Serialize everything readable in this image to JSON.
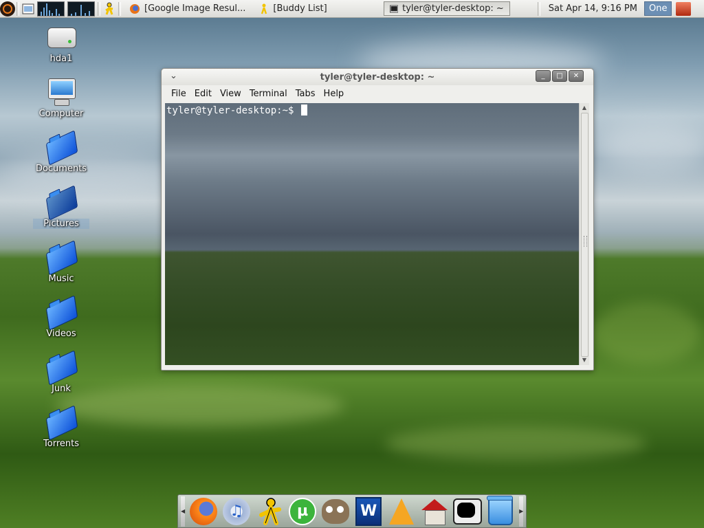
{
  "panel": {
    "tasks": [
      {
        "label": "[Google Image Resul...",
        "icon": "firefox-icon"
      },
      {
        "label": "[Buddy List]",
        "icon": "aim-icon"
      },
      {
        "label": "tyler@tyler-desktop: ~",
        "icon": "terminal-icon"
      }
    ],
    "clock": "Sat Apr 14,  9:16 PM",
    "workspace": "One"
  },
  "desktop_icons": [
    {
      "label": "hda1",
      "icon": "drive-icon"
    },
    {
      "label": "Computer",
      "icon": "computer-icon"
    },
    {
      "label": "Documents",
      "icon": "folder-icon"
    },
    {
      "label": "Pictures",
      "icon": "folder-icon"
    },
    {
      "label": "Music",
      "icon": "folder-icon"
    },
    {
      "label": "Videos",
      "icon": "folder-icon"
    },
    {
      "label": "Junk",
      "icon": "folder-icon"
    },
    {
      "label": "Torrents",
      "icon": "folder-icon"
    }
  ],
  "window": {
    "title": "tyler@tyler-desktop: ~",
    "menu": [
      "File",
      "Edit",
      "View",
      "Terminal",
      "Tabs",
      "Help"
    ],
    "prompt": "tyler@tyler-desktop:~$ "
  },
  "dock": {
    "items": [
      "firefox-icon",
      "music-icon",
      "aim-icon",
      "utorrent-icon",
      "gimp-icon",
      "word-icon",
      "vlc-icon",
      "home-icon",
      "terminal-icon",
      "trash-icon"
    ],
    "utorrent_glyph": "µ",
    "word_glyph": "W",
    "music_glyph": "♫"
  },
  "colors": {
    "accent": "#6c8fb4",
    "ubuntu_orange": "#e8791a"
  }
}
